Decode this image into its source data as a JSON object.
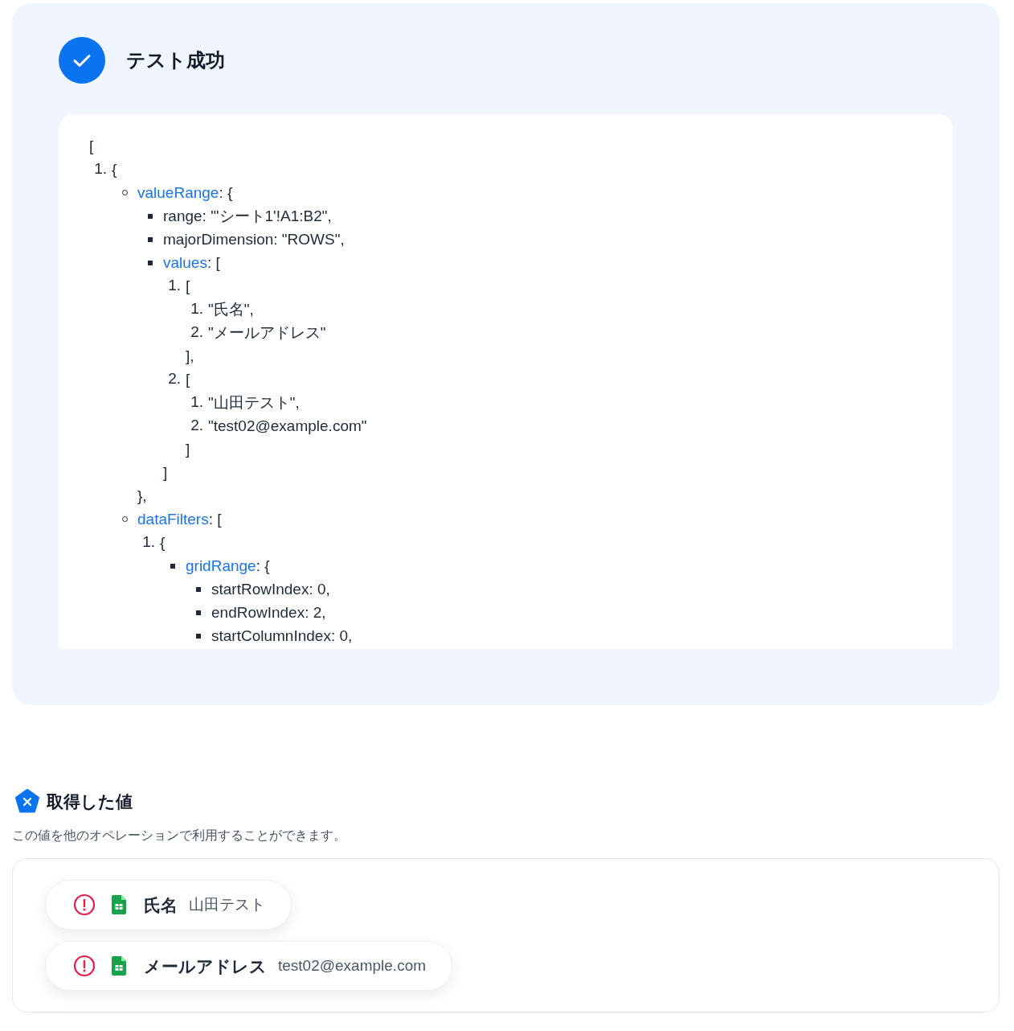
{
  "result": {
    "title": "テスト成功",
    "output": {
      "kind": "plain",
      "text": "[",
      "children": [
        {
          "kind": "number",
          "marker": "1.",
          "text": "{",
          "children": [
            {
              "kind": "circle",
              "key": "valueRange",
              "text": ": {",
              "children": [
                {
                  "kind": "square",
                  "text": "range: \"'シート1'!A1:B2\","
                },
                {
                  "kind": "square",
                  "text": "majorDimension: \"ROWS\","
                },
                {
                  "kind": "square",
                  "key": "values",
                  "text": ": [",
                  "children": [
                    {
                      "kind": "number",
                      "marker": "1.",
                      "text": "[",
                      "children": [
                        {
                          "kind": "number",
                          "marker": "1.",
                          "text": "\"氏名\","
                        },
                        {
                          "kind": "number",
                          "marker": "2.",
                          "text": "\"メールアドレス\""
                        }
                      ],
                      "close": "],"
                    },
                    {
                      "kind": "number",
                      "marker": "2.",
                      "text": "[",
                      "children": [
                        {
                          "kind": "number",
                          "marker": "1.",
                          "text": "\"山田テスト\","
                        },
                        {
                          "kind": "number",
                          "marker": "2.",
                          "text": "\"test02@example.com\""
                        }
                      ],
                      "close": "]"
                    }
                  ],
                  "close": "]"
                }
              ],
              "close": "},"
            },
            {
              "kind": "circle",
              "key": "dataFilters",
              "text": ": [",
              "children": [
                {
                  "kind": "number",
                  "marker": "1.",
                  "text": "{",
                  "children": [
                    {
                      "kind": "square",
                      "key": "gridRange",
                      "text": ": {",
                      "children": [
                        {
                          "kind": "square",
                          "text": "startRowIndex: 0,"
                        },
                        {
                          "kind": "square",
                          "text": "endRowIndex: 2,"
                        },
                        {
                          "kind": "square",
                          "text": "startColumnIndex: 0,"
                        }
                      ]
                    }
                  ]
                }
              ]
            }
          ]
        }
      ]
    }
  },
  "obtained_values": {
    "title": "取得した値",
    "description": "この値を他のオペレーションで利用することができます。",
    "items": [
      {
        "label": "氏名",
        "value": "山田テスト"
      },
      {
        "label": "メールアドレス",
        "value": "test02@example.com"
      }
    ]
  }
}
